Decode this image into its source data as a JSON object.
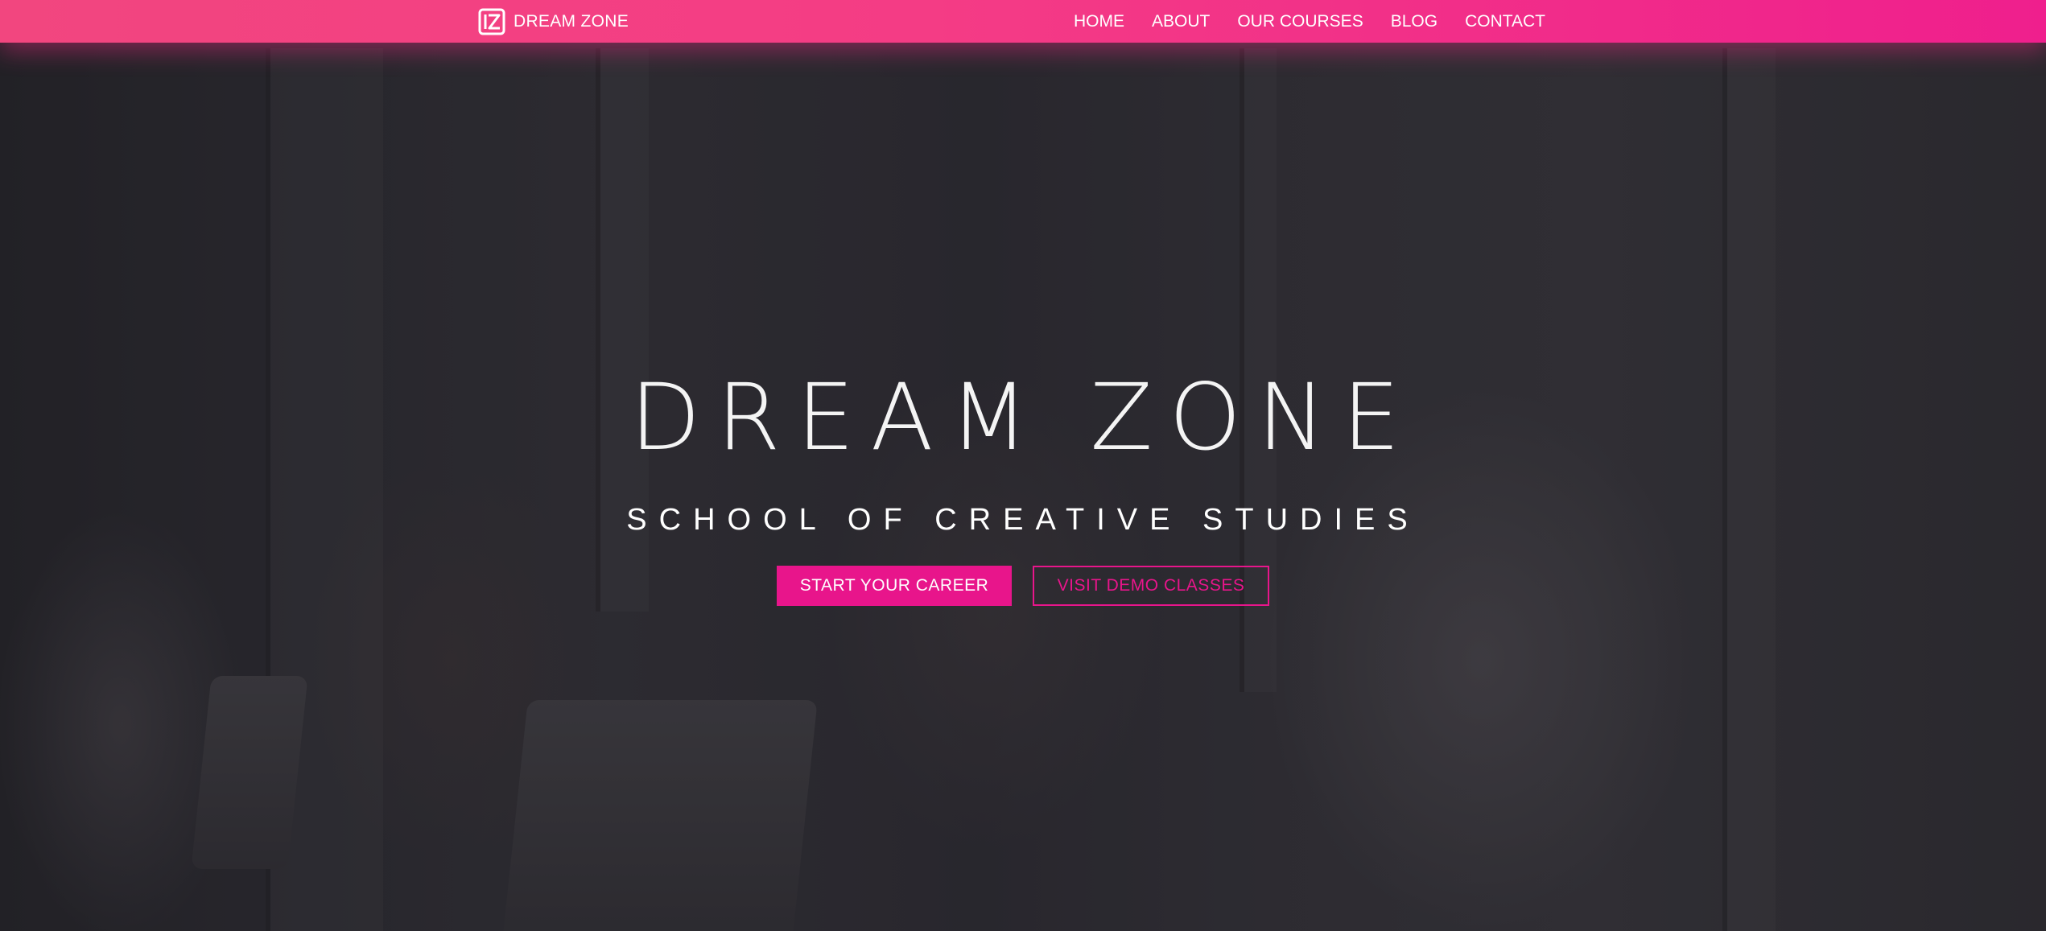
{
  "colors": {
    "accent": "#e8158b",
    "navbar_start": "#f2467f",
    "navbar_end": "#ef1f8d",
    "text_light": "#ffffff"
  },
  "navbar": {
    "brand": {
      "logo_icon": "dz-logo-icon",
      "name": "DREAM ZONE"
    },
    "links": [
      {
        "label": "HOME"
      },
      {
        "label": "ABOUT"
      },
      {
        "label": "OUR COURSES"
      },
      {
        "label": "BLOG"
      },
      {
        "label": "CONTACT"
      }
    ]
  },
  "hero": {
    "title": "DREAM ZONE",
    "subtitle": "SCHOOL OF CREATIVE STUDIES",
    "primary_button": "START YOUR CAREER",
    "secondary_button": "VISIT DEMO CLASSES",
    "background": "photo of students laughing around laptops (darkened)"
  }
}
